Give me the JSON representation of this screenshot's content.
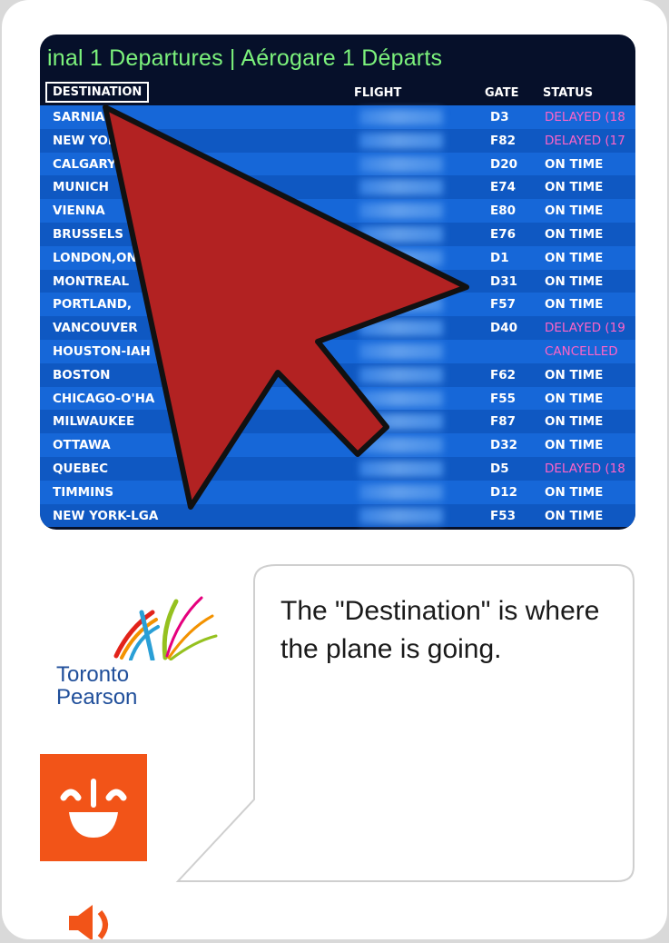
{
  "board": {
    "title": "inal 1 Departures | Aérogare 1 Départs",
    "headers": {
      "destination": "DESTINATION",
      "flight": "FLIGHT",
      "gate": "GATE",
      "status": "STATUS"
    },
    "rows": [
      {
        "destination": "SARNIA",
        "gate": "D3",
        "status": "DELAYED (18",
        "kind": "delayed"
      },
      {
        "destination": "NEW YORK",
        "gate": "F82",
        "status": "DELAYED (17",
        "kind": "delayed"
      },
      {
        "destination": "CALGARY",
        "gate": "D20",
        "status": "ON TIME",
        "kind": "ok"
      },
      {
        "destination": "MUNICH",
        "gate": "E74",
        "status": "ON TIME",
        "kind": "ok"
      },
      {
        "destination": "VIENNA",
        "gate": "E80",
        "status": "ON TIME",
        "kind": "ok"
      },
      {
        "destination": "BRUSSELS",
        "gate": "E76",
        "status": "ON TIME",
        "kind": "ok"
      },
      {
        "destination": "LONDON,ON",
        "gate": "D1",
        "status": "ON TIME",
        "kind": "ok"
      },
      {
        "destination": "MONTREAL",
        "gate": "D31",
        "status": "ON TIME",
        "kind": "ok"
      },
      {
        "destination": "PORTLAND,",
        "gate": "F57",
        "status": "ON TIME",
        "kind": "ok"
      },
      {
        "destination": "VANCOUVER",
        "gate": "D40",
        "status": "DELAYED (19",
        "kind": "delayed"
      },
      {
        "destination": "HOUSTON-IAH",
        "gate": "",
        "status": "CANCELLED",
        "kind": "cancelled"
      },
      {
        "destination": "BOSTON",
        "gate": "F62",
        "status": "ON TIME",
        "kind": "ok"
      },
      {
        "destination": "CHICAGO-O'HA",
        "gate": "F55",
        "status": "ON TIME",
        "kind": "ok"
      },
      {
        "destination": "MILWAUKEE",
        "gate": "F87",
        "status": "ON TIME",
        "kind": "ok"
      },
      {
        "destination": "OTTAWA",
        "gate": "D32",
        "status": "ON TIME",
        "kind": "ok"
      },
      {
        "destination": "QUEBEC",
        "gate": "D5",
        "status": "DELAYED (18",
        "kind": "delayed"
      },
      {
        "destination": "TIMMINS",
        "gate": "D12",
        "status": "ON TIME",
        "kind": "ok"
      },
      {
        "destination": "NEW YORK-LGA",
        "gate": "F53",
        "status": "ON TIME",
        "kind": "ok"
      }
    ]
  },
  "logo": {
    "line1": "Toronto",
    "line2": "Pearson"
  },
  "bubble": {
    "text": "The \"Destination\" is where the plane is going."
  },
  "icons": {
    "cursor": "cursor-arrow-icon",
    "mascot": "smile-face-icon",
    "audio": "speaker-icon"
  },
  "colors": {
    "cursor": "#b22222",
    "tile": "#f25418",
    "status_alert": "#ff63c8",
    "board_title": "#7cf27c"
  }
}
